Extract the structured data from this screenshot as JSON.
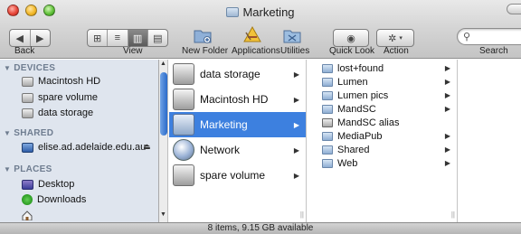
{
  "window": {
    "title": "Marketing"
  },
  "toolbar": {
    "back_label": "Back",
    "view_label": "View",
    "new_folder_label": "New Folder",
    "applications_label": "Applications",
    "utilities_label": "Utilities",
    "quick_look_label": "Quick Look",
    "action_label": "Action",
    "search_label": "Search",
    "search_value": ""
  },
  "sidebar": {
    "devices_header": "DEVICES",
    "devices": [
      {
        "label": "Macintosh HD",
        "icon": "hard-disk-icon"
      },
      {
        "label": "spare volume",
        "icon": "hard-disk-icon"
      },
      {
        "label": "data storage",
        "icon": "hard-disk-icon"
      }
    ],
    "shared_header": "SHARED",
    "shared": [
      {
        "label": "elise.ad.adelaide.edu.au",
        "icon": "network-computer-icon"
      }
    ],
    "places_header": "PLACES",
    "places": [
      {
        "label": "Desktop",
        "icon": "desktop-icon"
      },
      {
        "label": "Downloads",
        "icon": "downloads-icon"
      },
      {
        "label": "",
        "icon": "home-icon"
      }
    ]
  },
  "column1": {
    "items": [
      {
        "label": "data storage",
        "selected": false
      },
      {
        "label": "Macintosh HD",
        "selected": false
      },
      {
        "label": "Marketing",
        "selected": true
      },
      {
        "label": "Network",
        "selected": false
      },
      {
        "label": "spare volume",
        "selected": false
      }
    ]
  },
  "column2": {
    "items": [
      {
        "label": "lost+found",
        "has_children": true
      },
      {
        "label": "Lumen",
        "has_children": true
      },
      {
        "label": "Lumen pics",
        "has_children": true
      },
      {
        "label": "MandSC",
        "has_children": true
      },
      {
        "label": "MandSC alias",
        "has_children": false
      },
      {
        "label": "MediaPub",
        "has_children": true
      },
      {
        "label": "Shared",
        "has_children": true
      },
      {
        "label": "Web",
        "has_children": true
      }
    ]
  },
  "status": {
    "text": "8 items, 9.15 GB available"
  },
  "colors": {
    "selection": "#3d80df",
    "sidebar_bg": "#dfe5ee"
  }
}
